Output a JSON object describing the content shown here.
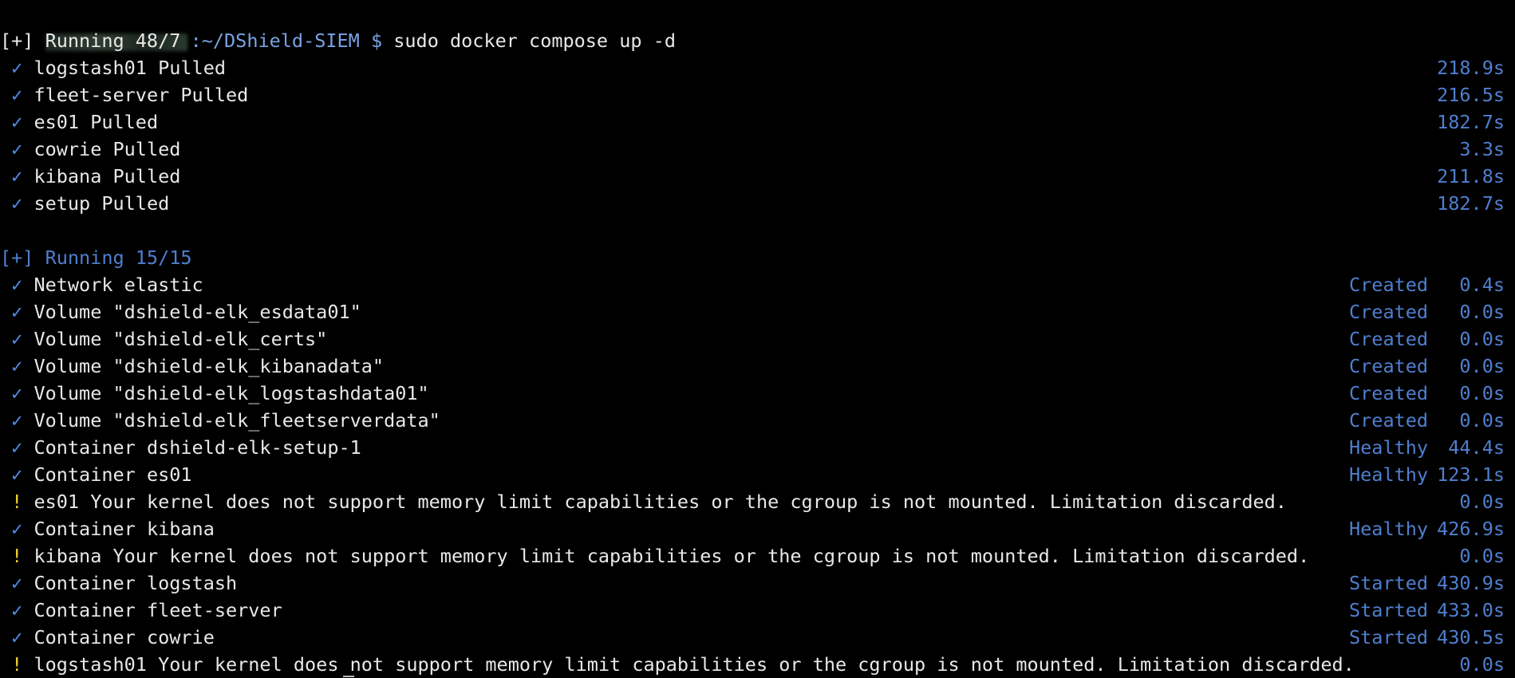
{
  "prompt": {
    "path": ":~/DShield-SIEM $ ",
    "command": "sudo docker compose up -d"
  },
  "icons": {
    "check": "✓",
    "warn": "!"
  },
  "colors": {
    "background": "#000000",
    "text": "#e8e8e8",
    "accent_blue": "#4f7fcf",
    "check_blue": "#4f8fe8",
    "warning_yellow": "#f2d230",
    "path_blue": "#7aa2e3"
  },
  "pull_section": {
    "header": "[+] Running 48/7",
    "items": [
      {
        "label": "logstash01 Pulled",
        "time": "218.9s"
      },
      {
        "label": "fleet-server Pulled",
        "time": "216.5s"
      },
      {
        "label": "es01 Pulled",
        "time": "182.7s"
      },
      {
        "label": "cowrie Pulled",
        "time": "3.3s"
      },
      {
        "label": "kibana Pulled",
        "time": "211.8s"
      },
      {
        "label": "setup Pulled",
        "time": "182.7s"
      }
    ]
  },
  "run_section": {
    "header": "[+] Running 15/15",
    "items": [
      {
        "label": "Network elastic",
        "status": "Created",
        "time": "0.4s"
      },
      {
        "label": "Volume \"dshield-elk_esdata01\"",
        "status": "Created",
        "time": "0.0s"
      },
      {
        "label": "Volume \"dshield-elk_certs\"",
        "status": "Created",
        "time": "0.0s"
      },
      {
        "label": "Volume \"dshield-elk_kibanadata\"",
        "status": "Created",
        "time": "0.0s"
      },
      {
        "label": "Volume \"dshield-elk_logstashdata01\"",
        "status": "Created",
        "time": "0.0s"
      },
      {
        "label": "Volume \"dshield-elk_fleetserverdata\"",
        "status": "Created",
        "time": "0.0s"
      },
      {
        "label": "Container dshield-elk-setup-1",
        "status": "Healthy",
        "time": "44.4s"
      },
      {
        "label": "Container es01",
        "status": "Healthy",
        "time": "123.1s"
      },
      {
        "label": "es01 Your kernel does not support memory limit capabilities or the cgroup is not mounted. Limitation discarded.",
        "status": "",
        "time": "0.0s"
      },
      {
        "label": "Container kibana",
        "status": "Healthy",
        "time": "426.9s"
      },
      {
        "label": "kibana Your kernel does not support memory limit capabilities or the cgroup is not mounted. Limitation discarded.",
        "status": "",
        "time": "0.0s"
      },
      {
        "label": "Container logstash",
        "status": "Started",
        "time": "430.9s"
      },
      {
        "label": "Container fleet-server",
        "status": "Started",
        "time": "433.0s"
      },
      {
        "label": "Container cowrie",
        "status": "Started",
        "time": "430.5s"
      },
      {
        "label": "logstash01 Your kernel does not support memory limit capabilities or the cgroup is not mounted. Limitation discarded.",
        "status": "",
        "time": "0.0s"
      }
    ]
  }
}
